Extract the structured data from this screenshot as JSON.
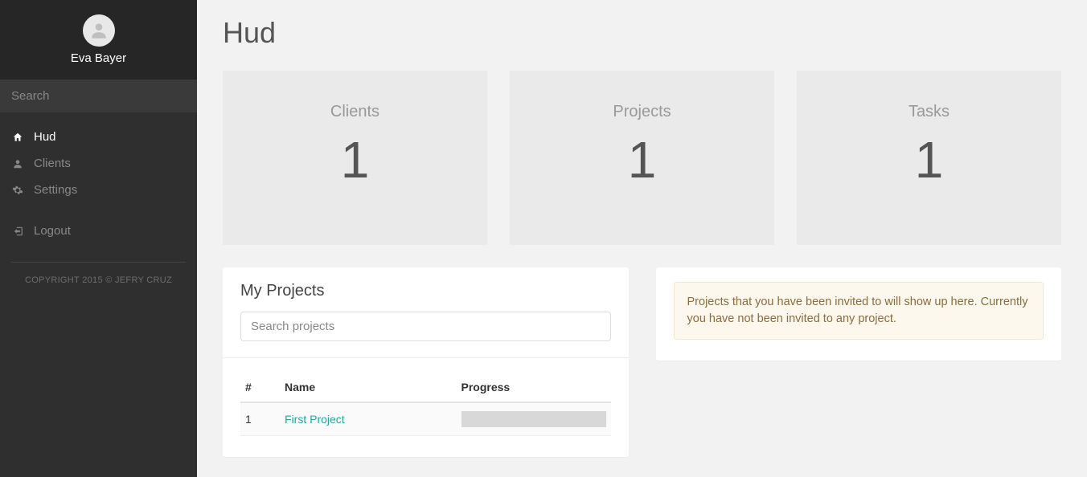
{
  "user": {
    "name": "Eva Bayer"
  },
  "search": {
    "placeholder": "Search"
  },
  "nav": {
    "hud": "Hud",
    "clients": "Clients",
    "settings": "Settings",
    "logout": "Logout"
  },
  "copyright": "COPYRIGHT 2015 © JEFRY CRUZ",
  "page": {
    "title": "Hud"
  },
  "stats": {
    "clients": {
      "label": "Clients",
      "value": "1"
    },
    "projects": {
      "label": "Projects",
      "value": "1"
    },
    "tasks": {
      "label": "Tasks",
      "value": "1"
    }
  },
  "projects_panel": {
    "heading": "My Projects",
    "search_placeholder": "Search projects",
    "columns": {
      "num": "#",
      "name": "Name",
      "progress": "Progress"
    },
    "rows": [
      {
        "num": "1",
        "name": "First Project"
      }
    ]
  },
  "invites_alert": "Projects that you have been invited to will show up here. Currently you have not been invited to any project."
}
